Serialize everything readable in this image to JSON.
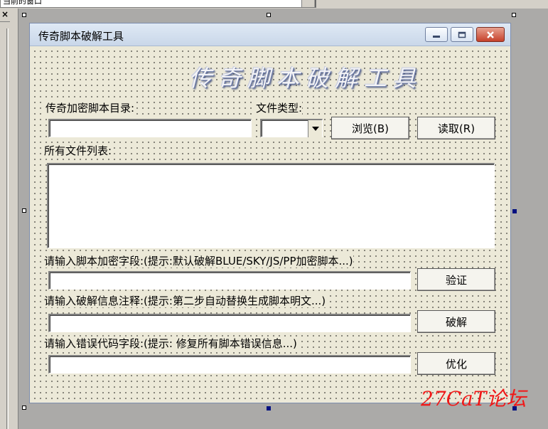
{
  "ide": {
    "top_combo_text": "当前的窗口",
    "panel_close_glyph": "×"
  },
  "window": {
    "title": "传奇脚本破解工具",
    "controls": {
      "minimize_glyph": "—",
      "restore_glyph": "▢",
      "close_glyph": "✕"
    }
  },
  "banner": {
    "text": "传奇脚本破解工具"
  },
  "form": {
    "dir_label": "传奇加密脚本目录:",
    "dir_value": "",
    "filetype_label": "文件类型:",
    "filetype_value": "",
    "browse_button": "浏览(B)",
    "read_button": "读取(R)",
    "filelist_label": "所有文件列表:",
    "field1_label": "请输入脚本加密字段:(提示:默认破解BLUE/SKY/JS/PP加密脚本...)",
    "field1_value": "",
    "verify_button": "验证",
    "field2_label": "请输入破解信息注释:(提示:第二步自动替换生成脚本明文...)",
    "field2_value": "",
    "crack_button": "破解",
    "field3_label": "请输入错误代码字段:(提示: 修复所有脚本错误信息...)",
    "field3_value": "",
    "optimize_button": "优化"
  },
  "watermark": {
    "text": "27CaT论坛"
  },
  "colors": {
    "canvas": "#abaaa8",
    "form_bg": "#ece9d8",
    "close_button": "#c6412b",
    "selection_handle": "#001080",
    "watermark": "#f01818"
  }
}
